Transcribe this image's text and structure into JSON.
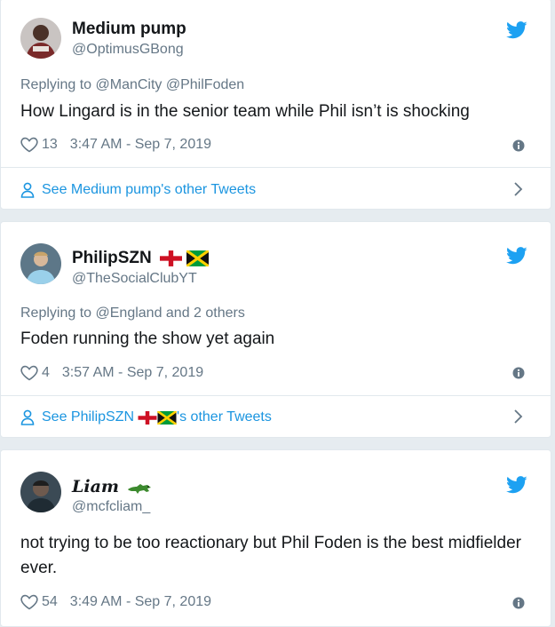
{
  "tweets": [
    {
      "name": "Medium pump",
      "handle": "@OptimusGBong",
      "replying_prefix": "Replying to",
      "replying_to": "@ManCity @PhilFoden",
      "text": "How Lingard is in the senior team while Phil isn’t is shocking",
      "likes": "13",
      "timestamp": "3:47 AM - Sep 7, 2019",
      "other_tweets": "See Medium pump's other Tweets"
    },
    {
      "name": "PhilipSZN",
      "handle": "@TheSocialClubYT",
      "replying_prefix": "Replying to",
      "replying_to": "@England and 2 others",
      "text": "Foden running the show yet again",
      "likes": "4",
      "timestamp": "3:57 AM - Sep 7, 2019",
      "other_prefix": "See PhilipSZN",
      "other_suffix": "'s other Tweets"
    },
    {
      "name": "Liam",
      "handle": "@mcfcliam_",
      "text": "not trying to be too reactionary but Phil Foden is the best midfielder ever.",
      "likes": "54",
      "timestamp": "3:49 AM - Sep 7, 2019"
    }
  ],
  "colors": {
    "twitter_blue": "#1da1f2",
    "link_blue": "#1b95e0",
    "secondary_text": "#657786",
    "background": "#e6ecf0"
  },
  "icons": [
    "twitter-bird-icon",
    "heart-icon",
    "info-icon",
    "person-icon",
    "chevron-right-icon",
    "england-flag-icon",
    "jamaica-flag-icon",
    "crocodile-emoji-icon"
  ]
}
